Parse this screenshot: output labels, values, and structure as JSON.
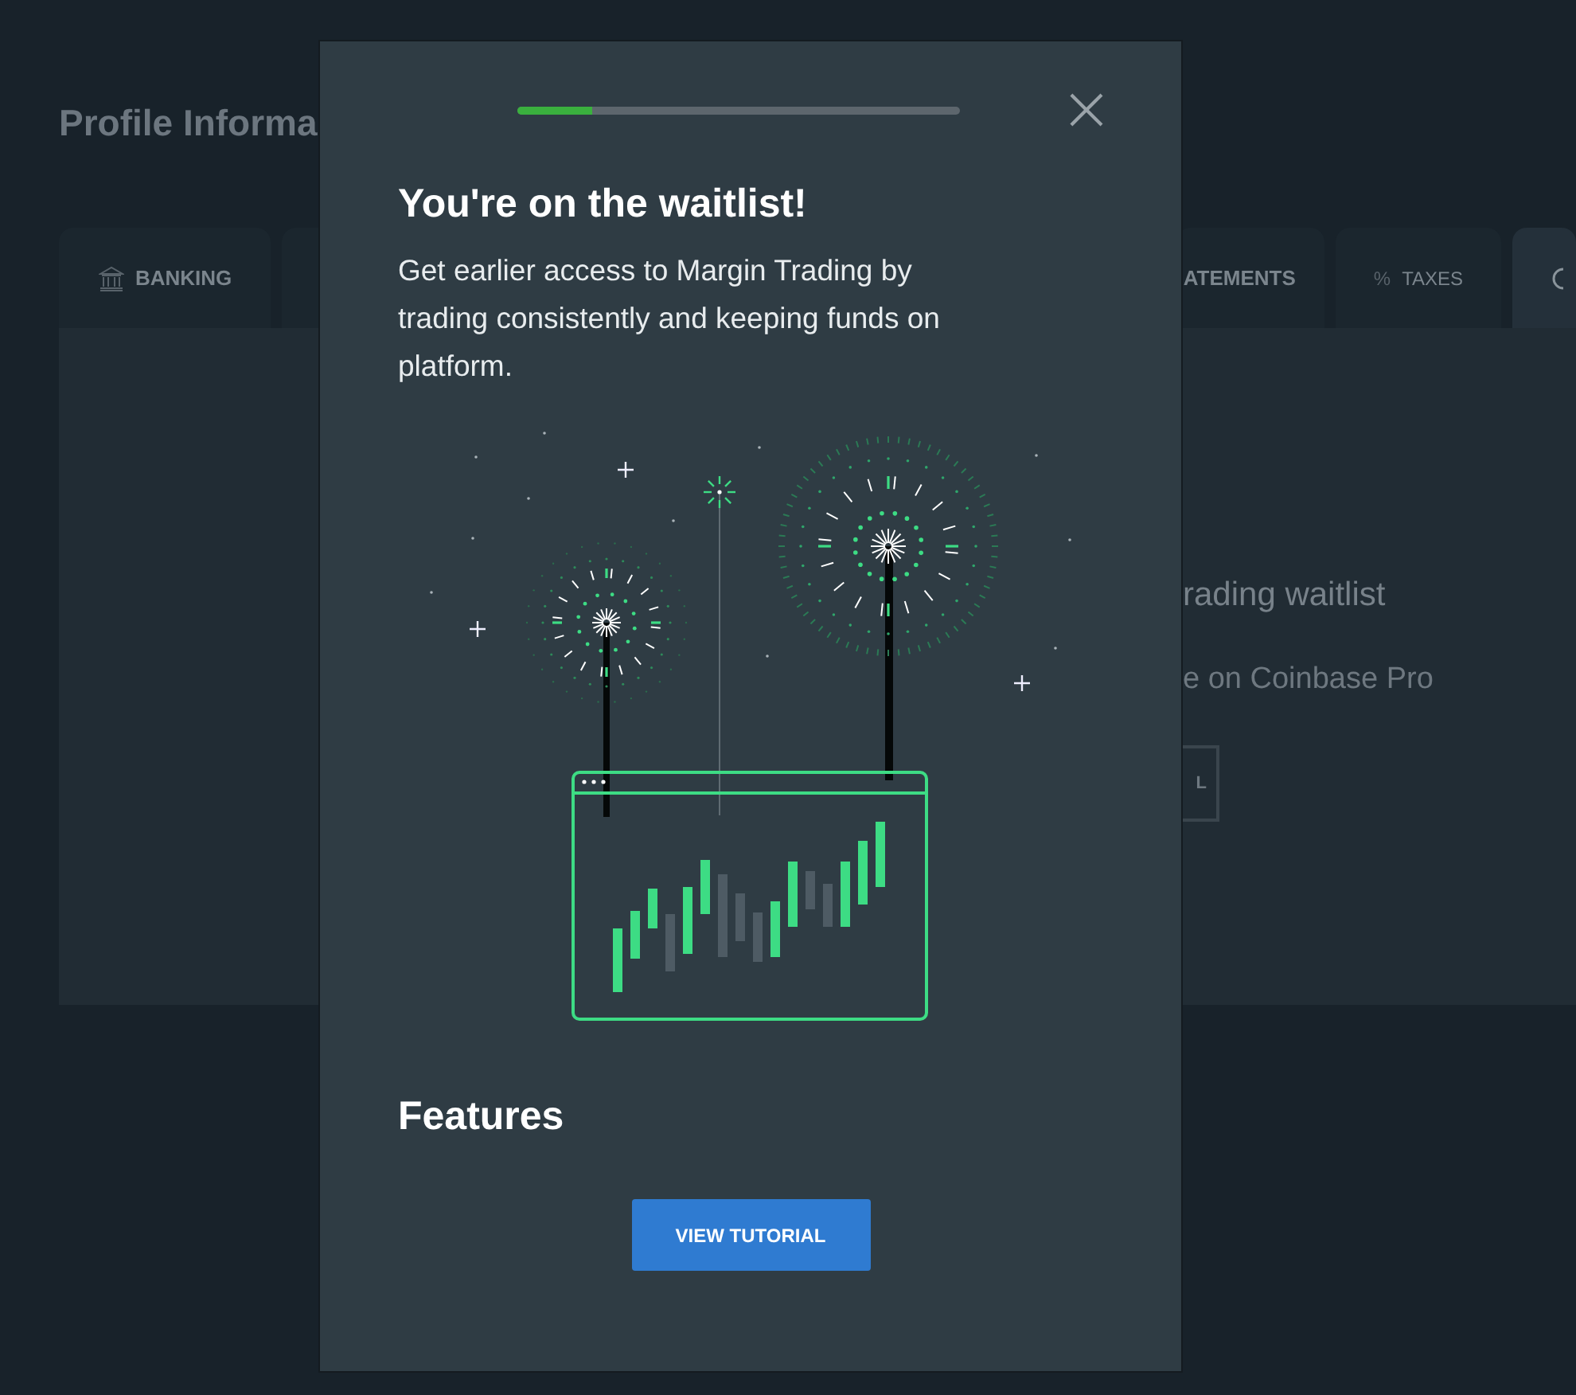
{
  "page": {
    "title": "Profile Informa",
    "tabs": [
      {
        "kind": "bank",
        "label": "BANKING",
        "selected": false
      },
      {
        "kind": "covered"
      },
      {
        "kind": "label",
        "label": "ATEMENTS",
        "selected": false
      },
      {
        "kind": "glyph",
        "glyph": "%",
        "label": "TAXES",
        "selected": false
      },
      {
        "kind": "ring",
        "selected": true
      }
    ],
    "panel": {
      "heading": "rading waitlist",
      "text": "e on Coinbase Pro",
      "button": "L"
    }
  },
  "modal": {
    "progress": {
      "level": 0.17
    },
    "title": "You're on the waitlist!",
    "body": "Get earlier access to Margin Trading by trading consistently and keeping funds on platform.",
    "features_heading": "Features",
    "button": "VIEW TUTORIAL"
  }
}
